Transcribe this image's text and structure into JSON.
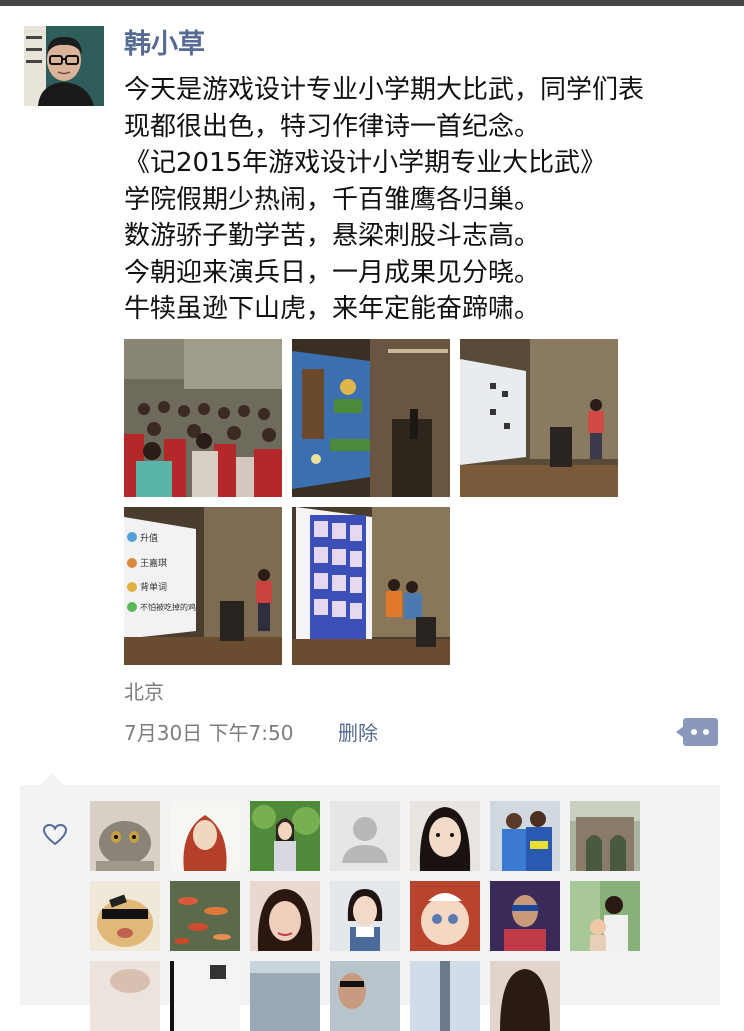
{
  "user": {
    "name": "韩小草",
    "avatar_icon": "profile-photo"
  },
  "post": {
    "lines": [
      "今天是游戏设计专业小学期大比武，同学们表",
      "现都很出色，特习作律诗一首纪念。",
      "《记2015年游戏设计小学期专业大比武》",
      "学院假期少热闹，千百雏鹰各归巢。",
      "数游骄子勤学苦，悬梁刺股斗志高。",
      "今朝迎来演兵日，一月成果见分晓。",
      "牛犊虽逊下山虎，来年定能奋蹄啸。"
    ],
    "photos": [
      {
        "name": "auditorium-audience-photo"
      },
      {
        "name": "game-screen-platformer-photo"
      },
      {
        "name": "presentation-stage-photo"
      },
      {
        "name": "slide-list-presentation-photo"
      },
      {
        "name": "character-grid-slide-photo"
      }
    ],
    "slide_items": [
      "升值",
      "王嘉琪",
      "背单词",
      "不怕被吃掉的鸡"
    ],
    "location": "北京",
    "timestamp": "7月30日 下午7:50",
    "delete_label": "删除"
  },
  "likes": {
    "icon": "heart-icon",
    "avatars": [
      {
        "name": "cat-avatar"
      },
      {
        "name": "illustrated-girl-avatar"
      },
      {
        "name": "girl-in-garden-avatar"
      },
      {
        "name": "default-avatar"
      },
      {
        "name": "girl-selfie-avatar"
      },
      {
        "name": "soccer-players-avatar"
      },
      {
        "name": "stone-arch-avatar"
      },
      {
        "name": "cool-cat-sunglasses-avatar"
      },
      {
        "name": "koi-fish-avatar"
      },
      {
        "name": "girl-portrait-avatar"
      },
      {
        "name": "girl-overalls-avatar"
      },
      {
        "name": "baby-avatar"
      },
      {
        "name": "man-blue-shirt-avatar"
      },
      {
        "name": "mother-baby-avatar"
      },
      {
        "name": "partial-avatar-1"
      },
      {
        "name": "partial-avatar-2"
      },
      {
        "name": "partial-avatar-3"
      },
      {
        "name": "partial-avatar-4"
      },
      {
        "name": "partial-avatar-5"
      },
      {
        "name": "partial-avatar-6"
      }
    ]
  },
  "colors": {
    "link": "#576b95",
    "meta_text": "#7d7d7d",
    "panel_bg": "#f3f3f5"
  }
}
